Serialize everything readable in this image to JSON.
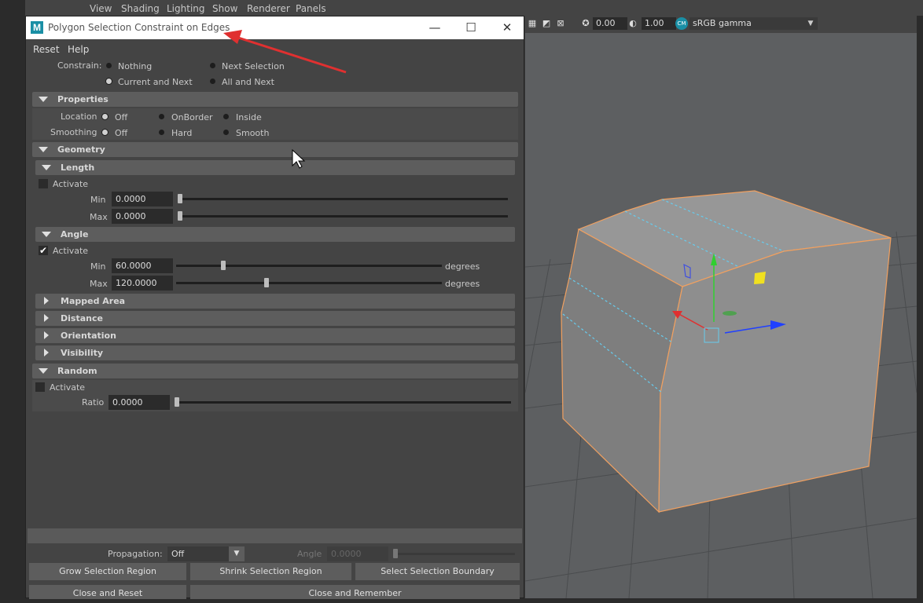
{
  "menubar": {
    "items": [
      "View",
      "Shading",
      "Lighting",
      "Show",
      "Renderer",
      "Panels"
    ]
  },
  "toolbar": {
    "exposure": "0.00",
    "gamma": "1.00",
    "colorspace": "sRGB gamma",
    "cm_badge": "CM"
  },
  "dialog": {
    "title": "Polygon Selection Constraint on Edges",
    "menu": [
      "Reset",
      "Help"
    ],
    "constrain": {
      "label": "Constrain:",
      "options": [
        "Nothing",
        "Next Selection",
        "Current and Next",
        "All and Next"
      ],
      "selected": "Current and Next"
    },
    "properties": {
      "header": "Properties",
      "location_label": "Location",
      "location_options": [
        "Off",
        "OnBorder",
        "Inside"
      ],
      "smoothing_label": "Smoothing",
      "smoothing_options": [
        "Off",
        "Hard",
        "Smooth"
      ]
    },
    "geometry": {
      "header": "Geometry",
      "length": {
        "header": "Length",
        "activate": "Activate",
        "active": false,
        "min_label": "Min",
        "min": "0.0000",
        "max_label": "Max",
        "max": "0.0000"
      },
      "angle": {
        "header": "Angle",
        "activate": "Activate",
        "active": true,
        "min_label": "Min",
        "min": "60.0000",
        "max_label": "Max",
        "max": "120.0000",
        "unit": "degrees"
      },
      "collapsed": [
        "Mapped Area",
        "Distance",
        "Orientation",
        "Visibility"
      ]
    },
    "random": {
      "header": "Random",
      "activate": "Activate",
      "ratio_label": "Ratio",
      "ratio": "0.0000"
    },
    "footer": {
      "propagation_label": "Propagation:",
      "propagation_value": "Off",
      "angle_label": "Angle",
      "angle_value": "0.0000",
      "buttons": [
        "Grow Selection Region",
        "Shrink Selection Region",
        "Select Selection Boundary"
      ],
      "close_buttons": [
        "Close and Reset",
        "Close and Remember"
      ]
    }
  },
  "colors": {
    "accent_arrow": "#e03030",
    "edge_highlight": "#f0a060",
    "selected_edge": "#66ccee"
  }
}
